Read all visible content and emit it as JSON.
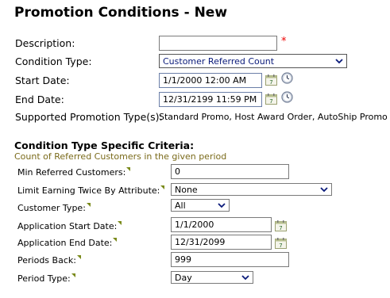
{
  "title": "Promotion Conditions - New",
  "form": {
    "description_label": "Description:",
    "description_value": "",
    "required_mark": "*",
    "condition_type_label": "Condition Type:",
    "condition_type_value": "Customer Referred Count",
    "start_date_label": "Start Date:",
    "start_date_value": "1/1/2000 12:00 AM",
    "end_date_label": "End Date:",
    "end_date_value": "12/31/2199 11:59 PM",
    "supported_label": "Supported Promotion Type(s):",
    "supported_value": "Standard Promo, Host Award Order, AutoShip Promo"
  },
  "criteria": {
    "section_title": "Condition Type Specific Criteria:",
    "subtitle": "Count of Referred Customers in the given period",
    "min_referred_label": "Min Referred Customers:",
    "min_referred_value": "0",
    "limit_earning_label": "Limit Earning Twice By Attribute:",
    "limit_earning_value": "None",
    "customer_type_label": "Customer Type:",
    "customer_type_value": "All",
    "app_start_label": "Application Start Date:",
    "app_start_value": "1/1/2000",
    "app_end_label": "Application End Date:",
    "app_end_value": "12/31/2099",
    "periods_back_label": "Periods Back:",
    "periods_back_value": "999",
    "period_type_label": "Period Type:",
    "period_type_value": "Day"
  },
  "colors": {
    "required": "#e00000",
    "subtitle": "#7a6a1a",
    "select_text": "#0a1a7a",
    "help_marker": "#7a8a1a"
  },
  "icons": [
    "calendar-icon",
    "clock-icon",
    "chevron-down-icon",
    "help-marker-icon"
  ]
}
